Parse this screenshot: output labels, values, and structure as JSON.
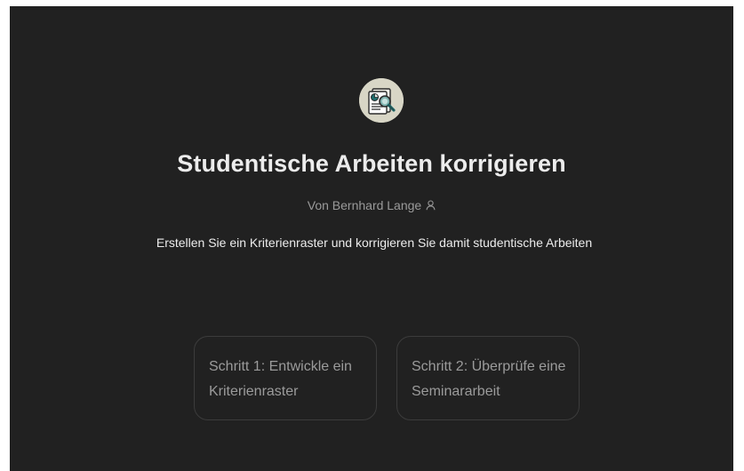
{
  "gpt": {
    "icon": "document-magnifier-icon",
    "title": "Studentische Arbeiten korrigieren",
    "author": "Von Bernhard Lange",
    "author_icon": "person-icon",
    "description": "Erstellen Sie ein Kriterienraster und korrigieren Sie damit studentische Arbeiten"
  },
  "starters": [
    {
      "label": "Schritt 1: Entwickle ein Kriterienraster"
    },
    {
      "label": "Schritt 2: Überprüfe eine Seminararbeit"
    }
  ],
  "colors": {
    "background": "#212121",
    "title_text": "#ececec",
    "muted_text": "#9a9a9a",
    "card_border": "#3c3c3c",
    "avatar_bg": "#d8d6c6",
    "accent_teal": "#1e6a6a"
  }
}
